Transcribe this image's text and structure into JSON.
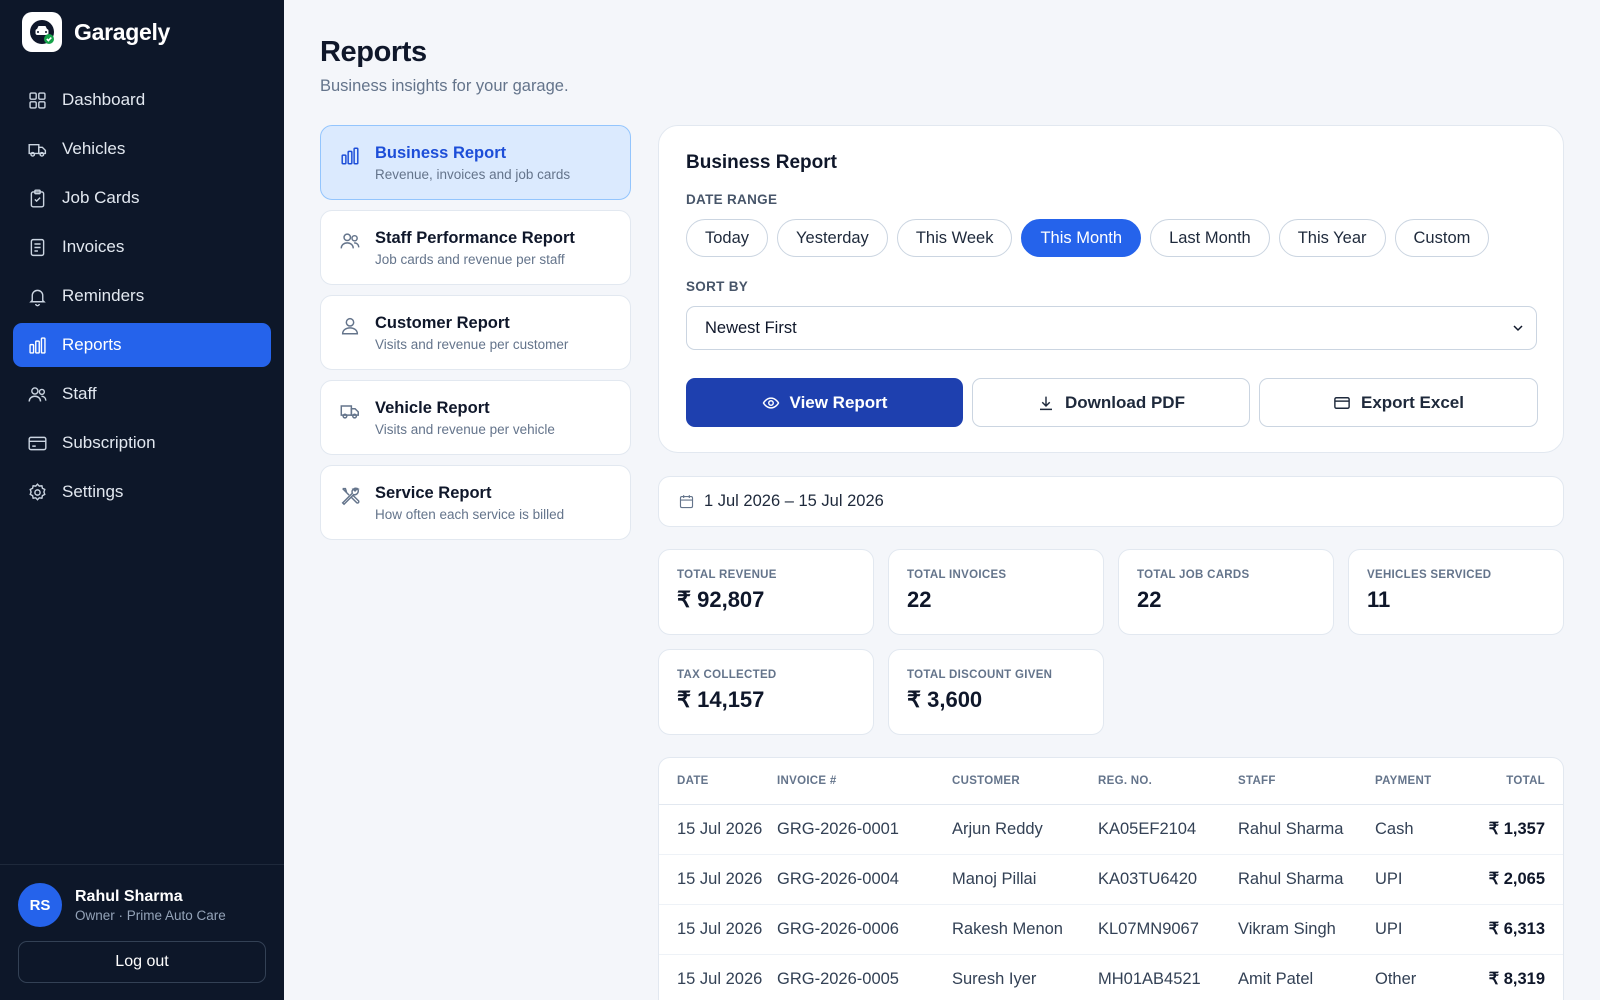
{
  "app": {
    "name": "Garagely"
  },
  "nav": {
    "items": [
      {
        "label": "Dashboard",
        "icon": "grid-icon"
      },
      {
        "label": "Vehicles",
        "icon": "truck-icon"
      },
      {
        "label": "Job Cards",
        "icon": "clipboard-icon"
      },
      {
        "label": "Invoices",
        "icon": "document-icon"
      },
      {
        "label": "Reminders",
        "icon": "bell-icon"
      },
      {
        "label": "Reports",
        "icon": "bar-chart-icon",
        "active": true
      },
      {
        "label": "Staff",
        "icon": "users-icon"
      },
      {
        "label": "Subscription",
        "icon": "credit-card-icon"
      },
      {
        "label": "Settings",
        "icon": "gear-icon"
      }
    ]
  },
  "user": {
    "initials": "RS",
    "name": "Rahul Sharma",
    "role": "Owner · Prime Auto Care",
    "logout_label": "Log out"
  },
  "page": {
    "title": "Reports",
    "subtitle": "Business insights for your garage."
  },
  "reports": [
    {
      "title": "Business Report",
      "desc": "Revenue, invoices and job cards",
      "icon": "bar-chart-icon",
      "active": true
    },
    {
      "title": "Staff Performance Report",
      "desc": "Job cards and revenue per staff",
      "icon": "users-icon"
    },
    {
      "title": "Customer Report",
      "desc": "Visits and revenue per customer",
      "icon": "user-icon"
    },
    {
      "title": "Vehicle Report",
      "desc": "Visits and revenue per vehicle",
      "icon": "truck-icon"
    },
    {
      "title": "Service Report",
      "desc": "How often each service is billed",
      "icon": "tools-icon"
    }
  ],
  "filters": {
    "title": "Business Report",
    "date_range_label": "DATE RANGE",
    "chips": [
      {
        "label": "Today"
      },
      {
        "label": "Yesterday"
      },
      {
        "label": "This Week"
      },
      {
        "label": "This Month",
        "active": true
      },
      {
        "label": "Last Month"
      },
      {
        "label": "This Year"
      },
      {
        "label": "Custom"
      }
    ],
    "sort_label": "SORT BY",
    "sort_value": "Newest First",
    "view_label": "View Report",
    "pdf_label": "Download PDF",
    "excel_label": "Export Excel"
  },
  "date_range": "1 Jul 2026 – 15 Jul 2026",
  "stats": [
    {
      "label": "TOTAL REVENUE",
      "value": "₹ 92,807"
    },
    {
      "label": "TOTAL INVOICES",
      "value": "22"
    },
    {
      "label": "TOTAL JOB CARDS",
      "value": "22"
    },
    {
      "label": "VEHICLES SERVICED",
      "value": "11"
    },
    {
      "label": "TAX COLLECTED",
      "value": "₹ 14,157"
    },
    {
      "label": "TOTAL DISCOUNT GIVEN",
      "value": "₹ 3,600"
    }
  ],
  "table": {
    "columns": [
      "DATE",
      "INVOICE #",
      "CUSTOMER",
      "REG. NO.",
      "STAFF",
      "PAYMENT",
      "TOTAL"
    ],
    "rows": [
      [
        "15 Jul 2026",
        "GRG-2026-0001",
        "Arjun Reddy",
        "KA05EF2104",
        "Rahul Sharma",
        "Cash",
        "₹ 1,357"
      ],
      [
        "15 Jul 2026",
        "GRG-2026-0004",
        "Manoj Pillai",
        "KA03TU6420",
        "Rahul Sharma",
        "UPI",
        "₹ 2,065"
      ],
      [
        "15 Jul 2026",
        "GRG-2026-0006",
        "Rakesh Menon",
        "KL07MN9067",
        "Vikram Singh",
        "UPI",
        "₹ 6,313"
      ],
      [
        "15 Jul 2026",
        "GRG-2026-0005",
        "Suresh Iyer",
        "MH01AB4521",
        "Amit Patel",
        "Other",
        "₹ 8,319"
      ]
    ]
  },
  "colors": {
    "sidebar_bg": "#0d1729",
    "accent": "#2563eb",
    "primary_button": "#1e40af",
    "page_bg": "#f4f6fa"
  }
}
